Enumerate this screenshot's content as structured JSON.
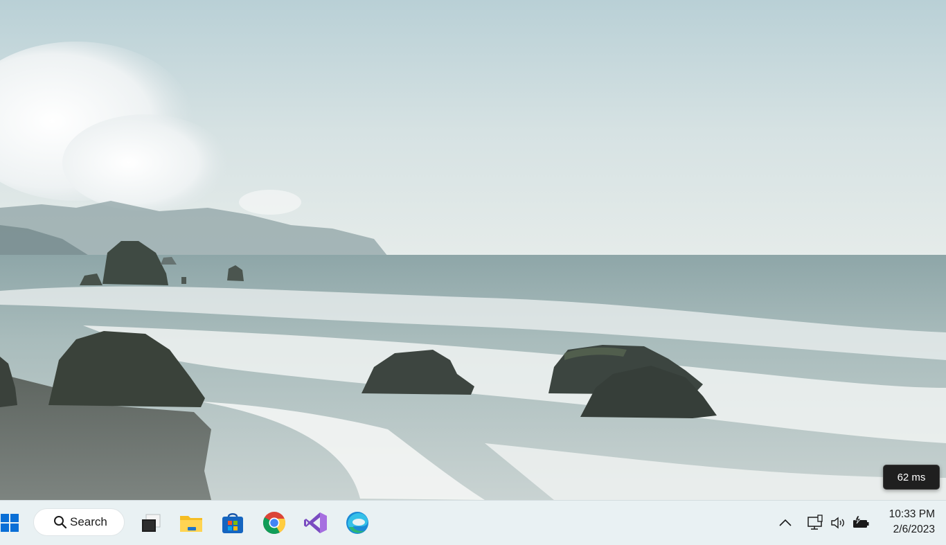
{
  "wallpaper": {
    "description_icon": "coastal-sea-stacks-wallpaper"
  },
  "tooltip": {
    "text": "62 ms"
  },
  "taskbar": {
    "start_icon": "windows-logo-icon",
    "search": {
      "label": "Search",
      "icon": "search-icon"
    },
    "apps": [
      {
        "name": "task-view",
        "icon": "task-view-icon"
      },
      {
        "name": "file-explorer",
        "icon": "folder-icon"
      },
      {
        "name": "microsoft-store",
        "icon": "store-bag-icon"
      },
      {
        "name": "google-chrome",
        "icon": "chrome-icon"
      },
      {
        "name": "visual-studio",
        "icon": "visual-studio-icon"
      },
      {
        "name": "microsoft-edge",
        "icon": "edge-icon"
      }
    ],
    "tray": {
      "overflow_icon": "chevron-up-icon",
      "network_icon": "network-monitor-icon",
      "volume_icon": "speaker-icon",
      "battery_icon": "battery-charging-icon"
    },
    "clock": {
      "time": "10:33 PM",
      "date": "2/6/2023"
    }
  },
  "colors": {
    "taskbar_bg": "#e9f1f3",
    "tooltip_bg": "#1f1f1f",
    "windows_blue": "#0a6fd6"
  }
}
